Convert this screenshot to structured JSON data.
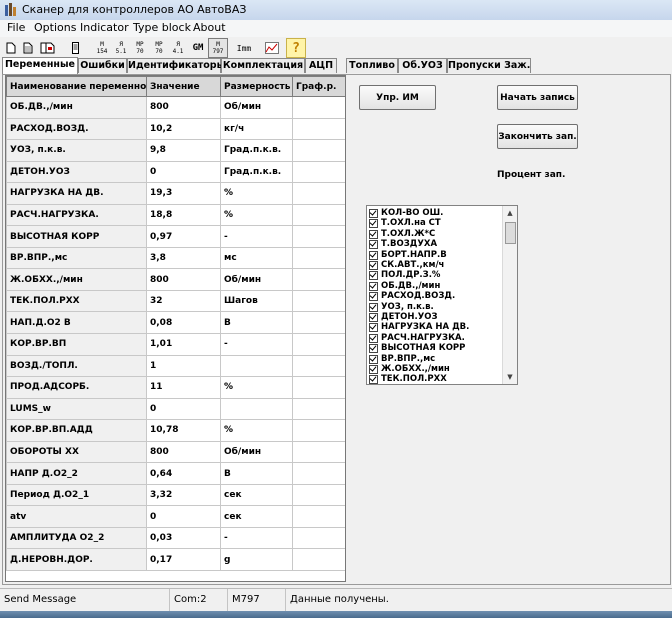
{
  "window": {
    "title": "Сканер для  контроллеров АО АвтоВАЗ"
  },
  "menu": [
    "File",
    "Options",
    "Indicator",
    "Type block",
    "About"
  ],
  "toolbar": [
    {
      "name": "new-icon",
      "text": ""
    },
    {
      "name": "open-icon",
      "text": ""
    },
    {
      "name": "save-icon",
      "text": ""
    },
    {
      "name": "device-icon",
      "text": ""
    },
    {
      "name": "m154-button",
      "text": "M\n154"
    },
    {
      "name": "ya51-button",
      "text": "Я\n5.1"
    },
    {
      "name": "mp70-button",
      "text": "MP\n70"
    },
    {
      "name": "mp70b-button",
      "text": "MP\n70"
    },
    {
      "name": "ya41-button",
      "text": "Я\n4.1"
    },
    {
      "name": "gm-button",
      "text": "GM"
    },
    {
      "name": "m797-button",
      "text": "M\n797"
    },
    {
      "name": "imm-button",
      "text": "Imm"
    },
    {
      "name": "chart-icon",
      "text": ""
    },
    {
      "name": "help-icon",
      "text": "?"
    }
  ],
  "tabs": [
    "Переменные",
    "Ошибки",
    "Идентификаторы",
    "Комплектация",
    "АЦП",
    "Топливо",
    "Об.УОЗ",
    "Пропуски Заж."
  ],
  "table": {
    "headers": [
      "Наименование переменной",
      "Значение",
      "Размерность",
      "Граф.р."
    ],
    "rows": [
      [
        "ОБ.ДВ.,/мин",
        "800",
        "Об/мин",
        ""
      ],
      [
        "РАСХОД.ВОЗД.",
        "10,2",
        "кг/ч",
        ""
      ],
      [
        "УОЗ, п.к.в.",
        "9,8",
        "Град.п.к.в.",
        ""
      ],
      [
        "ДЕТОН.УОЗ",
        "0",
        "Град.п.к.в.",
        ""
      ],
      [
        "НАГРУЗКА НА ДВ.",
        "19,3",
        "%",
        ""
      ],
      [
        "РАСЧ.НАГРУЗКА.",
        "18,8",
        "%",
        ""
      ],
      [
        "ВЫСОТНАЯ КОРР",
        "0,97",
        "-",
        ""
      ],
      [
        "ВР.ВПР.,мс",
        "3,8",
        "мс",
        ""
      ],
      [
        "Ж.ОБХХ.,/мин",
        "800",
        "Об/мин",
        ""
      ],
      [
        "ТЕК.ПОЛ.РХХ",
        "32",
        "Шагов",
        ""
      ],
      [
        "НАП.Д.О2 В",
        "0,08",
        "В",
        ""
      ],
      [
        "КОР.ВР.ВП",
        "1,01",
        "-",
        ""
      ],
      [
        "ВОЗД./ТОПЛ.",
        "1",
        "",
        ""
      ],
      [
        "ПРОД.АДСОРБ.",
        "11",
        "%",
        ""
      ],
      [
        "LUMS_w",
        "0",
        "",
        ""
      ],
      [
        "КОР.ВР.ВП.АДД",
        "10,78",
        "%",
        ""
      ],
      [
        "ОБОРОТЫ ХХ",
        "800",
        "Об/мин",
        ""
      ],
      [
        "НАПР Д.О2_2",
        "0,64",
        "В",
        ""
      ],
      [
        "Период Д.О2_1",
        "3,32",
        "сек",
        ""
      ],
      [
        "atv",
        "0",
        "сек",
        ""
      ],
      [
        "АМПЛИТУДА О2_2",
        "0,03",
        "-",
        ""
      ],
      [
        "Д.НЕРОВН.ДОР.",
        "0,17",
        "g",
        ""
      ]
    ]
  },
  "buttons": {
    "upr_im": "Упр. ИМ",
    "start_record": "Начать запись",
    "stop_record": "Закончить зап."
  },
  "percent_label": "Процент зап.",
  "checklist": [
    "КОЛ-ВО ОШ.",
    "Т.ОХЛ.на СТ",
    "Т.ОХЛ.Ж*С",
    "Т.ВОЗДУХА",
    "БОРТ.НАПР.В",
    "СК.АВТ.,км/ч",
    "ПОЛ.ДР.З.%",
    "ОБ.ДВ.,/мин",
    "РАСХОД.ВОЗД.",
    "УОЗ, п.к.в.",
    "ДЕТОН.УОЗ",
    "НАГРУЗКА НА ДВ.",
    "РАСЧ.НАГРУЗКА.",
    "ВЫСОТНАЯ КОРР",
    "ВР.ВПР.,мс",
    "Ж.ОБХХ.,/мин",
    "ТЕК.ПОЛ.РХХ"
  ],
  "status": {
    "message": "Send Message",
    "port": "Com:2",
    "model": "M797",
    "text": "Данные получены."
  }
}
